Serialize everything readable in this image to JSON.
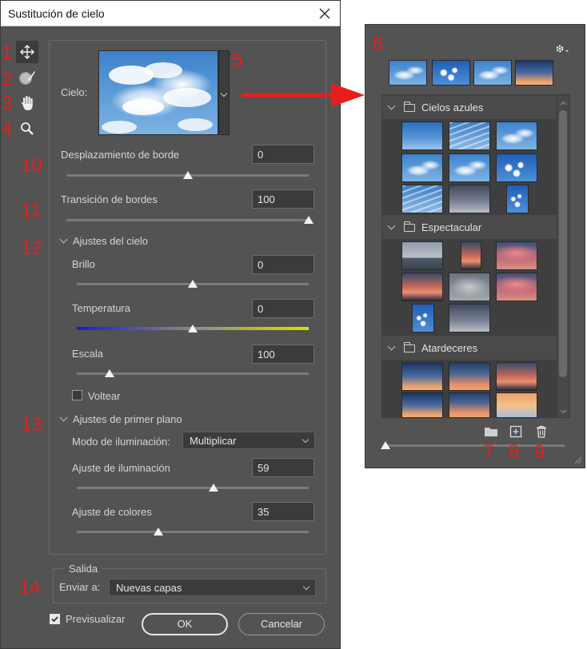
{
  "dialog": {
    "title": "Sustitución de cielo",
    "sky_label": "Cielo:",
    "fields": {
      "edge_shift": {
        "label": "Desplazamiento de borde",
        "value": "0",
        "level": 0.5
      },
      "edge_fade": {
        "label": "Transición de bordes",
        "value": "100",
        "level": 1.0
      }
    },
    "sky_adjustments": {
      "header": "Ajustes del cielo",
      "brightness": {
        "label": "Brillo",
        "value": "0",
        "level": 0.5
      },
      "temperature": {
        "label": "Temperatura",
        "value": "0",
        "level": 0.5
      },
      "scale": {
        "label": "Escala",
        "value": "100",
        "level": 0.14
      },
      "flip_label": "Voltear",
      "flip_checked": false
    },
    "foreground_adjustments": {
      "header": "Ajustes de primer plano",
      "lighting_mode_label": "Modo de iluminación:",
      "lighting_mode_value": "Multiplicar",
      "lighting_adjust": {
        "label": "Ajuste de iluminación",
        "value": "59",
        "level": 0.59
      },
      "color_adjust": {
        "label": "Ajuste de colores",
        "value": "35",
        "level": 0.35
      }
    },
    "output": {
      "group_label": "Salida",
      "send_to_label": "Enviar a:",
      "send_to_value": "Nuevas capas"
    },
    "preview_label": "Previsualizar",
    "preview_checked": true,
    "ok_label": "OK",
    "cancel_label": "Cancelar"
  },
  "tools": [
    "move-tool",
    "sky-brush-tool",
    "hand-tool",
    "zoom-tool"
  ],
  "panel": {
    "groups": [
      {
        "name": "Cielos azules"
      },
      {
        "name": "Espectacular"
      },
      {
        "name": "Atardeceres"
      }
    ],
    "size_level": 0.0
  },
  "annotations": [
    "1",
    "2",
    "3",
    "4",
    "5",
    "6",
    "7",
    "8",
    "9",
    "10",
    "11",
    "12",
    "13",
    "14"
  ],
  "colors": {
    "dialog_bg": "#535353",
    "field_bg": "#3b3b3b",
    "annotation_red": "#e81e1e",
    "text": "#d6d6d6"
  }
}
